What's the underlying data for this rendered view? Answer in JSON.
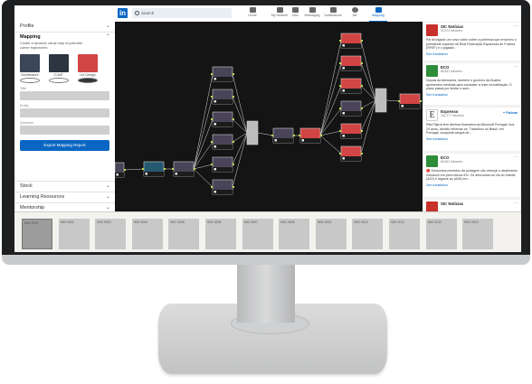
{
  "nav": {
    "logo": "in",
    "search_placeholder": "Search",
    "items": [
      {
        "label": "Home",
        "icon": "home-icon"
      },
      {
        "label": "My Network",
        "icon": "network-icon"
      },
      {
        "label": "Jobs",
        "icon": "briefcase-icon"
      },
      {
        "label": "Messaging",
        "icon": "messaging-icon"
      },
      {
        "label": "Notifications",
        "icon": "bell-icon"
      },
      {
        "label": "Me",
        "icon": "avatar-icon"
      },
      {
        "label": "Mapping",
        "icon": "mapping-icon"
      }
    ]
  },
  "left": {
    "profile": "Profile",
    "mapping_title": "Mapping",
    "mapping_desc": "Create a dynamic visual map of potential career trajectories",
    "options": [
      {
        "label": "Architecture",
        "selected": false
      },
      {
        "label": "D-MIT",
        "selected": false
      },
      {
        "label": "UX Design",
        "selected": true
      }
    ],
    "fields": [
      {
        "label": "Title",
        "value": ""
      },
      {
        "label": "Entity",
        "value": ""
      },
      {
        "label": "Question",
        "value": ""
      }
    ],
    "export_label": "Export Mapping Report",
    "sections": [
      "Stock",
      "Learning Resources",
      "Mentorship"
    ]
  },
  "feed": [
    {
      "avatar": "red",
      "name": "SIC Notícias",
      "sub": "90,574 followers",
      "action": "more",
      "text": "Pai divulgado um novo vídeo sobre a polémica que envolveu o presidente superior da Real Federação Espanhola de Futebol (RFEF) e o jogador...",
      "translate": "See translation"
    },
    {
      "avatar": "green",
      "name": "ECO",
      "sub": "68,541 followers",
      "action": "more",
      "text": "Depois da Alemanha, também o governo da Áustria apresentou medidas para combater a crise na habitação. O plano passa por limitar o aum...",
      "translate": "See translation"
    },
    {
      "avatar": "white",
      "glyph": "E",
      "name": "Expresso",
      "sub": "161,277 followers",
      "action": "+ Follow",
      "text": "Rita Pijarra tem diretora financeira da Microsoft Portugal. Aos 24 anos, decidiu reformar-se. Trabalhou no Brasil, em Portugal, conquista cargos de...",
      "translate": "See translation"
    },
    {
      "avatar": "green",
      "name": "ECO",
      "sub": "68,541 followers",
      "action": "more",
      "text": "🔴 Descontos previstos da portagem vão reforçar o abatimento introduzir em pelo menos 8%. Os descontos na Via do Infante (A22) e Algarve ao (A28) em...",
      "translate": "See translation"
    },
    {
      "avatar": "red",
      "name": "SIC Notícias",
      "sub": "",
      "action": "more",
      "text": "",
      "translate": ""
    }
  ],
  "strip": {
    "tiles": [
      "IMG 0001",
      "IMG 0002",
      "IMG 0003",
      "IMG 0004",
      "IMG 0005",
      "IMG 0006",
      "IMG 0007",
      "IMG 0008",
      "IMG 0009",
      "IMG 0010",
      "IMG 0011",
      "IMG 0012",
      "IMG 0013"
    ],
    "selected_index": 0
  },
  "colors": {
    "accent": "#0a66c2",
    "node_dark": "#4a4458",
    "node_red": "#d24545",
    "node_teal": "#25596f",
    "edge": "#b8e04a"
  }
}
